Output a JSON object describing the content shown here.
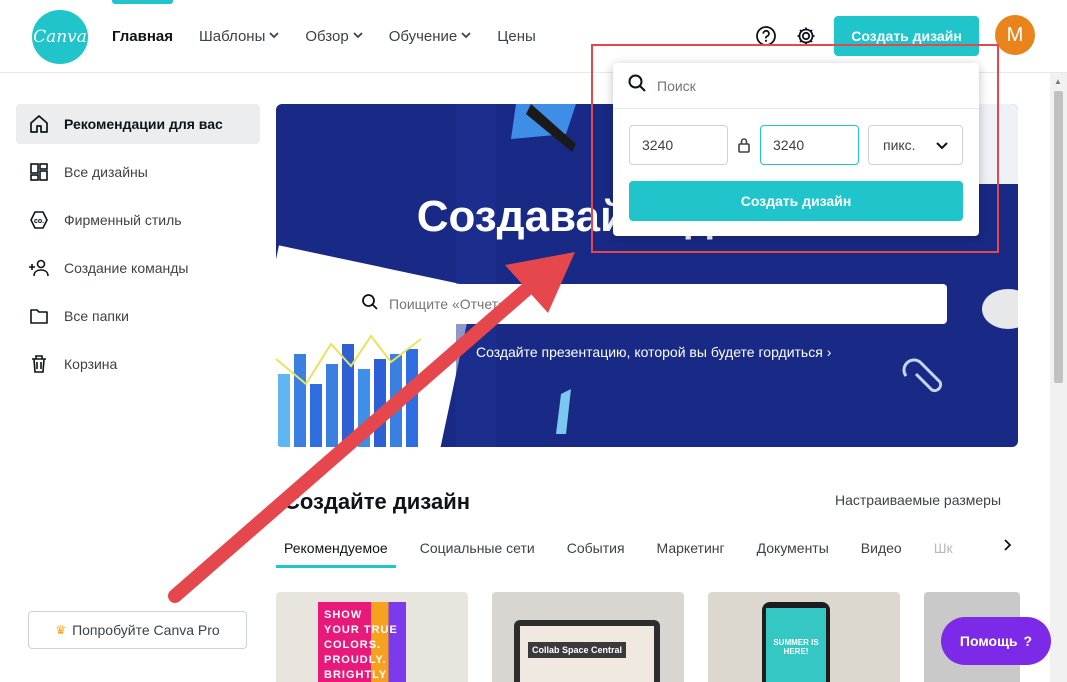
{
  "header": {
    "logo_text": "Canva",
    "nav": [
      {
        "label": "Главная",
        "dropdown": false,
        "active": true
      },
      {
        "label": "Шаблоны",
        "dropdown": true
      },
      {
        "label": "Обзор",
        "dropdown": true
      },
      {
        "label": "Обучение",
        "dropdown": true
      },
      {
        "label": "Цены",
        "dropdown": false
      }
    ],
    "create_button": "Создать дизайн",
    "avatar_letter": "M",
    "icons": [
      "help-icon",
      "settings-icon"
    ]
  },
  "sidebar": {
    "items": [
      {
        "label": "Рекомендации для вас",
        "icon": "home-icon"
      },
      {
        "label": "Все дизайны",
        "icon": "grid-icon"
      },
      {
        "label": "Фирменный стиль",
        "icon": "brand-icon"
      },
      {
        "label": "Создание команды",
        "icon": "team-icon"
      },
      {
        "label": "Все папки",
        "icon": "folder-icon"
      },
      {
        "label": "Корзина",
        "icon": "trash-icon"
      }
    ],
    "pro_button": "Попробуйте Canva Pro"
  },
  "hero": {
    "title": "Создавайте дизайны",
    "search_placeholder": "Поищите «Отчет»",
    "subtitle": "Создайте презентацию, которой вы будете гордиться ›"
  },
  "section": {
    "title": "Создайте дизайн",
    "custom_sizes": "Настраиваемые размеры",
    "tabs": [
      "Рекомендуемое",
      "Социальные сети",
      "События",
      "Маркетинг",
      "Документы",
      "Видео",
      "Шк"
    ]
  },
  "cards": {
    "poster_text": "SHOW YOUR TRUE COLORS. PROUDLY. BRIGHTLY",
    "laptop_text": "Collab Space Central",
    "phone_text": "SUMMER IS HERE!"
  },
  "popup": {
    "search_placeholder": "Поиск",
    "width": "3240",
    "height": "3240",
    "unit": "пикс.",
    "create_button": "Создать дизайн"
  },
  "help_button": "Помощь",
  "colors": {
    "accent": "#20c4cb",
    "hero_bg": "#192a86",
    "help_purple": "#7d2ae8",
    "avatar": "#e8841b",
    "annotation_red": "#e5474d"
  }
}
